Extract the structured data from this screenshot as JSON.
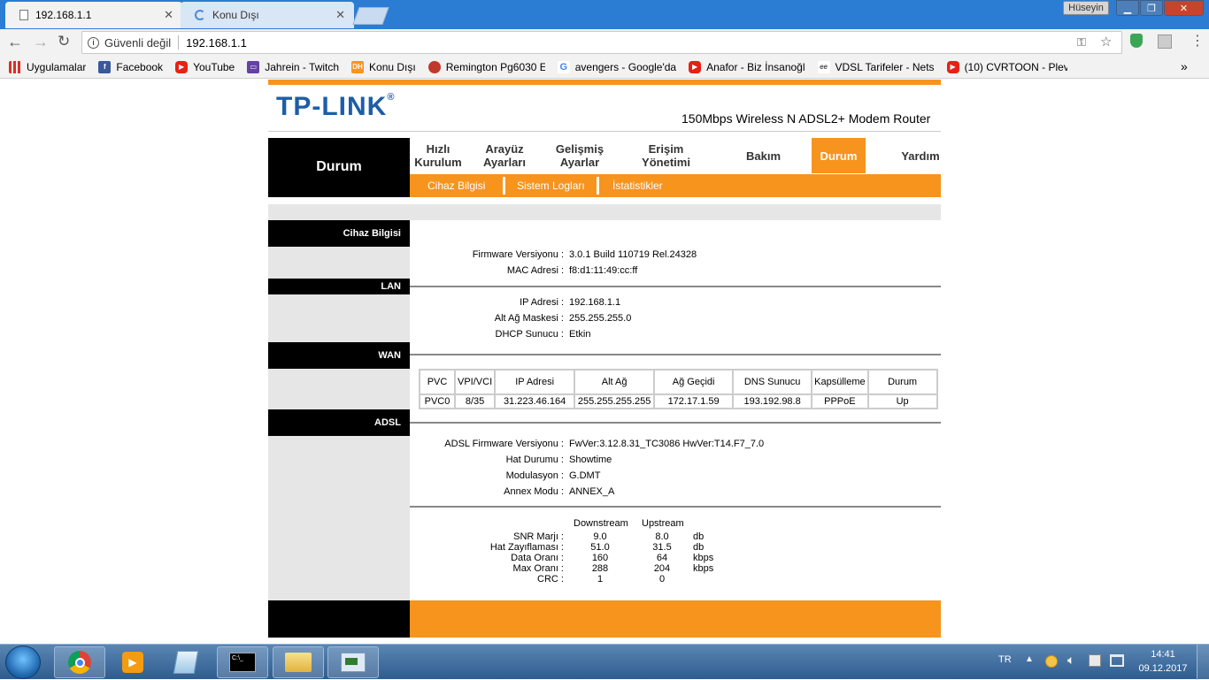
{
  "browser": {
    "tabs": [
      {
        "title": "192.168.1.1",
        "icon": "page-icon"
      },
      {
        "title": "Konu Dışı",
        "icon": "loading-icon"
      }
    ],
    "user": "Hüseyin",
    "security_label": "Güvenli değil",
    "url": "192.168.1.1",
    "bookmarks": [
      {
        "label": "Uygulamalar",
        "icon": "apps-icon"
      },
      {
        "label": "Facebook",
        "icon": "facebook-icon"
      },
      {
        "label": "YouTube",
        "icon": "youtube-icon"
      },
      {
        "label": "Jahrein - Twitch",
        "icon": "twitch-icon"
      },
      {
        "label": "Konu Dışı",
        "icon": "dh-icon"
      },
      {
        "label": "Remington Pg6030 E",
        "icon": "ladybug-icon"
      },
      {
        "label": "avengers - Google'da",
        "icon": "google-icon"
      },
      {
        "label": "Anafor - Biz İnsanoğl",
        "icon": "youtube-icon"
      },
      {
        "label": "VDSL Tarifeler - Nets",
        "icon": "ee-icon"
      },
      {
        "label": "(10) CVRTOON - Plev",
        "icon": "youtube-icon"
      }
    ],
    "more_bookmarks": "»"
  },
  "router": {
    "logo": "TP-LINK",
    "logo_mark": "®",
    "model": "150Mbps Wireless N ADSL2+ Modem Router",
    "section_title": "Durum",
    "nav": [
      {
        "label": "Hızlı\nKurulum"
      },
      {
        "label": "Arayüz\nAyarları"
      },
      {
        "label": "Gelişmiş\nAyarlar"
      },
      {
        "label": "Erişim\nYönetimi"
      },
      {
        "label": "Bakım"
      },
      {
        "label": "Durum"
      },
      {
        "label": "Yardım"
      }
    ],
    "subnav": [
      "Cihaz Bilgisi",
      "Sistem Logları",
      "İstatistikler"
    ],
    "device_section": "Cihaz Bilgisi",
    "firmware_label": "Firmware Versiyonu :",
    "firmware_value": "3.0.1 Build 110719 Rel.24328",
    "mac_label": "MAC Adresi :",
    "mac_value": "f8:d1:11:49:cc:ff",
    "lan_section": "LAN",
    "lan_ip_label": "IP Adresi :",
    "lan_ip_value": "192.168.1.1",
    "lan_mask_label": "Alt Ağ Maskesi :",
    "lan_mask_value": "255.255.255.0",
    "dhcp_label": "DHCP Sunucu :",
    "dhcp_value": "Etkin",
    "wan_section": "WAN",
    "wan_headers": [
      "PVC",
      "VPI/VCI",
      "IP Adresi",
      "Alt Ağ",
      "Ağ Geçidi",
      "DNS Sunucu",
      "Kapsülleme",
      "Durum"
    ],
    "wan_row": [
      "PVC0",
      "8/35",
      "31.223.46.164",
      "255.255.255.255",
      "172.17.1.59",
      "193.192.98.8",
      "PPPoE",
      "Up"
    ],
    "adsl_section": "ADSL",
    "adsl_fw_label": "ADSL Firmware Versiyonu :",
    "adsl_fw_value": "FwVer:3.12.8.31_TC3086 HwVer:T14.F7_7.0",
    "line_state_label": "Hat Durumu :",
    "line_state_value": "Showtime",
    "modulation_label": "Modulasyon :",
    "modulation_value": "G.DMT",
    "annex_label": "Annex Modu :",
    "annex_value": "ANNEX_A",
    "stats_headers": [
      "Downstream",
      "Upstream"
    ],
    "stats": [
      {
        "label": "SNR Marjı :",
        "down": "9.0",
        "up": "8.0",
        "unit": "db"
      },
      {
        "label": "Hat Zayıflaması :",
        "down": "51.0",
        "up": "31.5",
        "unit": "db"
      },
      {
        "label": "Data Oranı :",
        "down": "160",
        "up": "64",
        "unit": "kbps"
      },
      {
        "label": "Max Oranı :",
        "down": "288",
        "up": "204",
        "unit": "kbps"
      },
      {
        "label": "CRC :",
        "down": "1",
        "up": "0",
        "unit": ""
      }
    ]
  },
  "taskbar": {
    "lang": "TR",
    "time": "14:41",
    "date": "09.12.2017"
  },
  "colors": {
    "accent": "#f7941d",
    "tplink_blue": "#1c5ea8",
    "titlebar": "#2b7cd3"
  }
}
